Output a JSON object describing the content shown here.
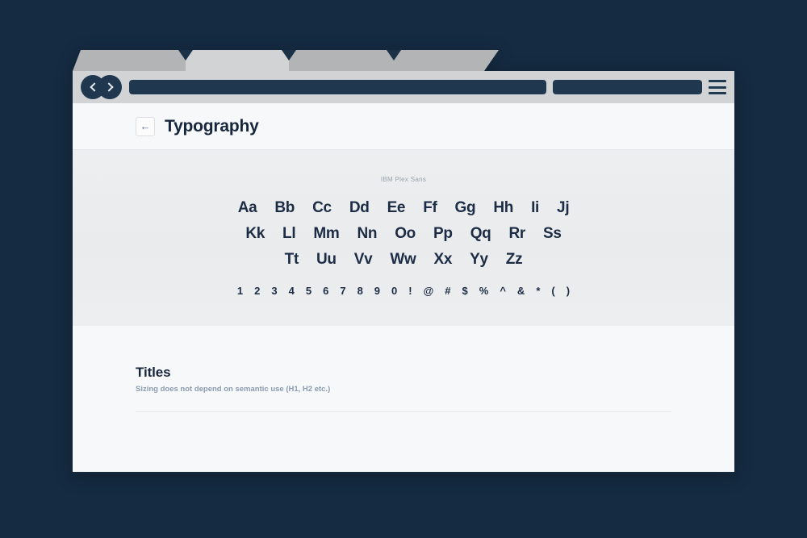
{
  "window": {
    "accent_navy": "#1f3850",
    "page_background": "#152b42",
    "chrome_gray": "#d2d3d5",
    "tab_inactive": "#b3b4b6"
  },
  "browser": {
    "tabs": [
      {
        "id": "tab-1",
        "state": "inactive"
      },
      {
        "id": "tab-2",
        "state": "active"
      },
      {
        "id": "tab-3",
        "state": "inactive"
      },
      {
        "id": "tab-4",
        "state": "inactive"
      }
    ],
    "toolbar": {
      "back_icon": "chevron-left-icon",
      "forward_icon": "chevron-right-icon",
      "url_value": "",
      "url_placeholder": "",
      "search_value": "",
      "search_placeholder": "",
      "menu_icon": "hamburger-menu-icon"
    }
  },
  "page": {
    "back_arrow": "←",
    "title": "Typography",
    "specimen": {
      "font_name": "IBM Plex Sans",
      "rows": [
        [
          "Aa",
          "Bb",
          "Cc",
          "Dd",
          "Ee",
          "Ff",
          "Gg",
          "Hh",
          "Ii",
          "Jj"
        ],
        [
          "Kk",
          "Ll",
          "Mm",
          "Nn",
          "Oo",
          "Pp",
          "Qq",
          "Rr",
          "Ss"
        ],
        [
          "Tt",
          "Uu",
          "Vv",
          "Ww",
          "Xx",
          "Yy",
          "Zz"
        ]
      ],
      "symbols": [
        "1",
        "2",
        "3",
        "4",
        "5",
        "6",
        "7",
        "8",
        "9",
        "0",
        "!",
        "@",
        "#",
        "$",
        "%",
        "^",
        "&",
        "*",
        "(",
        ")"
      ]
    },
    "titles": {
      "heading": "Titles",
      "subtitle": "Sizing does not depend on semantic use (H1, H2 etc.)"
    }
  }
}
